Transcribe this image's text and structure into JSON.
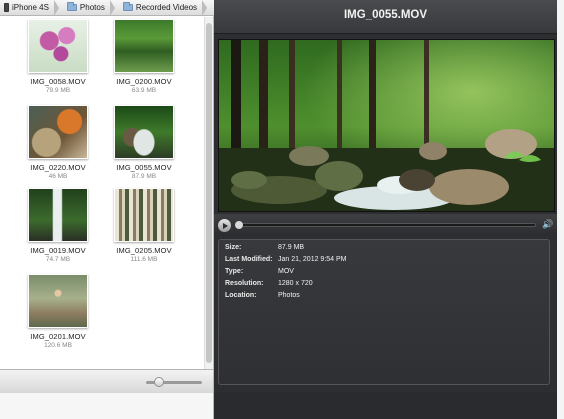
{
  "breadcrumb": [
    {
      "label": "iPhone 4S",
      "icon": "phone-icon"
    },
    {
      "label": "Photos",
      "icon": "folder-icon"
    },
    {
      "label": "Recorded Videos",
      "icon": "folder-icon"
    }
  ],
  "thumbnails": [
    {
      "name": "IMG_0058.MOV",
      "size": "79.9 MB"
    },
    {
      "name": "IMG_0200.MOV",
      "size": "63.9 MB"
    },
    {
      "name": "IMG_0220.MOV",
      "size": "46 MB"
    },
    {
      "name": "IMG_0055.MOV",
      "size": "87.9 MB"
    },
    {
      "name": "IMG_0019.MOV",
      "size": "74.7 MB"
    },
    {
      "name": "IMG_0205.MOV",
      "size": "111.6 MB"
    },
    {
      "name": "IMG_0201.MOV",
      "size": "120.6 MB"
    }
  ],
  "viewer": {
    "title": "IMG_0055.MOV",
    "playback_progress": 0.0
  },
  "info": {
    "rows": [
      {
        "key": "Size:",
        "value": "87.9 MB"
      },
      {
        "key": "Last Modified:",
        "value": "Jan 21, 2012 9:54 PM"
      },
      {
        "key": "Type:",
        "value": "MOV"
      },
      {
        "key": "Resolution:",
        "value": "1280 x 720"
      },
      {
        "key": "Location:",
        "value": "Photos"
      }
    ]
  },
  "colors": {
    "viewer_bg": "#2d2e31",
    "folder_blue": "#8fb3d9"
  }
}
